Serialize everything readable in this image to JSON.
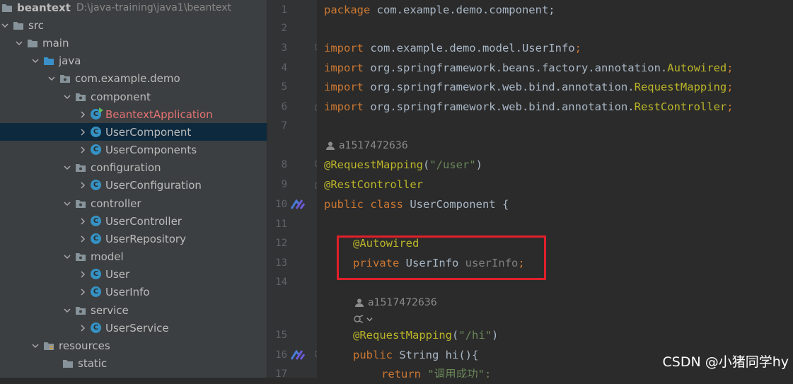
{
  "project": {
    "name": "beantext",
    "path": "D:\\java-training\\java1\\beantext"
  },
  "tree": [
    {
      "label": "src",
      "type": "folder"
    },
    {
      "label": "main",
      "type": "folder"
    },
    {
      "label": "java",
      "type": "folder-blue"
    },
    {
      "label": "com.example.demo",
      "type": "package"
    },
    {
      "label": "component",
      "type": "package"
    },
    {
      "label": "BeantextApplication",
      "type": "class-run"
    },
    {
      "label": "UserComponent",
      "type": "class",
      "selected": true
    },
    {
      "label": "UserComponents",
      "type": "class"
    },
    {
      "label": "configuration",
      "type": "package"
    },
    {
      "label": "UserConfiguration",
      "type": "class"
    },
    {
      "label": "controller",
      "type": "package"
    },
    {
      "label": "UserController",
      "type": "class"
    },
    {
      "label": "UserRepository",
      "type": "class"
    },
    {
      "label": "model",
      "type": "package"
    },
    {
      "label": "User",
      "type": "class"
    },
    {
      "label": "UserInfo",
      "type": "class"
    },
    {
      "label": "service",
      "type": "package"
    },
    {
      "label": "UserService",
      "type": "class"
    },
    {
      "label": "resources",
      "type": "folder-res"
    },
    {
      "label": "static",
      "type": "folder"
    }
  ],
  "lines": {
    "l1": "1",
    "l2": "2",
    "l3": "3",
    "l4": "4",
    "l5": "5",
    "l6": "6",
    "l7": "7",
    "l8": "8",
    "l9": "9",
    "l10": "10",
    "l11": "11",
    "l12": "12",
    "l13": "13",
    "l14": "14",
    "l15": "15",
    "l16": "16",
    "l17": "17"
  },
  "code": {
    "pkg_kw": "package",
    "pkg_name": " com.example.demo.component;",
    "imp": "import",
    "imp1_path": " com.example.demo.model.UserInfo",
    "imp2_path": " org.springframework.beans.factory.annotation.",
    "imp2_cls": "Autowired",
    "imp3_path": " org.springframework.web.bind.annotation.",
    "imp3_cls": "RequestMapping",
    "imp4_path": " org.springframework.web.bind.annotation.",
    "imp4_cls": "RestController",
    "semi": ";",
    "author1": "a1517472636",
    "ann_request": "@RequestMapping",
    "req_open": "(",
    "req_str": "\"/user\"",
    "req_close": ")",
    "ann_rest": "@RestController",
    "cls_kw": "public class",
    "cls_name": " UserComponent {",
    "ann_autowired": "@Autowired",
    "priv_kw": "private",
    "field_type": " UserInfo ",
    "field_name": "userInfo",
    "author2": "a1517472636",
    "ann_request2": "@RequestMapping",
    "hi_open": "(",
    "hi_str": "\"/hi\"",
    "hi_close": ")",
    "pub_kw": "public",
    "method_sig": " String hi(){",
    "ret_kw": "return",
    "ret_str": " \"调用成功\";"
  },
  "watermark": "CSDN @小猪同学hy",
  "colors": {
    "keyword": "#cc7832",
    "annotation": "#bbb529",
    "string": "#6a8759",
    "field": "#9876aa",
    "highlight_box": "#e0202a",
    "selected_row": "#0d293e"
  }
}
